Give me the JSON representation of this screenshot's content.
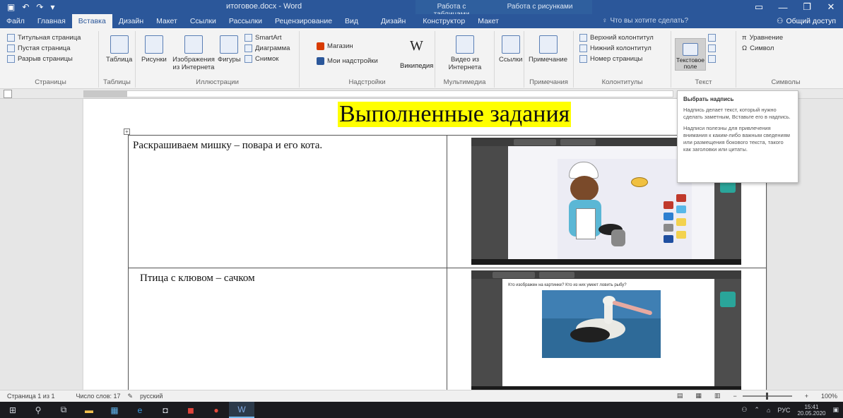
{
  "titlebar": {
    "save_icon": "save-icon",
    "undo_icon": "undo-icon",
    "redo_icon": "redo-icon",
    "doc_title": "итоговое.docx - Word",
    "ctx_tables": "Работа с таблицами",
    "ctx_pictures": "Работа с рисунками",
    "minimize": "—",
    "maximize": "❐",
    "close": "✕"
  },
  "tabs": [
    "Файл",
    "Главная",
    "Вставка",
    "Дизайн",
    "Макет",
    "Ссылки",
    "Рассылки",
    "Рецензирование",
    "Вид",
    "Дизайн",
    "Конструктор",
    "Макет"
  ],
  "active_tab_index": 2,
  "tell_me": "Что вы хотите сделать?",
  "share_label": "Общий доступ",
  "ribbon": {
    "pages": [
      "Титульная страница",
      "Пустая страница",
      "Разрыв страницы"
    ],
    "pages_label": "Страницы",
    "table_btn": "Таблица",
    "tables_label": "Таблицы",
    "pictures": "Рисунки",
    "online_pictures": "Изображения из Интернета",
    "shapes": "Фигуры",
    "smartart": "SmartArt",
    "chart": "Диаграмма",
    "screenshot": "Снимок",
    "illustrations_label": "Иллюстрации",
    "store": "Магазин",
    "my_addins": "Мои надстройки",
    "wikipedia": "Википедия",
    "addins_label": "Надстройки",
    "online_video": "Видео из Интернета",
    "media_label": "Мультимедиа",
    "links": "Ссылки",
    "comment": "Примечание",
    "comments_label": "Примечания",
    "header": "Верхний колонтитул",
    "footer": "Нижний колонтитул",
    "page_number": "Номер страницы",
    "hf_label": "Колонтитулы",
    "text_box": "Текстовое поле",
    "text_label": "Текст",
    "equation": "Уравнение",
    "symbol": "Символ",
    "symbols_label": "Символы"
  },
  "tooltip": {
    "title": "Выбрать надпись",
    "p1": "Надпись делает текст, который нужно сделать заметным, Вставьте его в надпись.",
    "p2": "Надписи полезны для привлечения внимания к каким-либо важным сведениям или размещения бокового текста, такого как заголовки или цитаты."
  },
  "document": {
    "heading": "Выполненные задания",
    "rows": [
      {
        "text": "Раскрашиваем мишку – повара и его кота."
      },
      {
        "text": "Птица с клювом – сачком",
        "question": "Кто изображен на картинке? Кто из них умеет ловить рыбу?"
      }
    ]
  },
  "statusbar": {
    "page": "Страница 1 из 1",
    "words": "Число слов: 17",
    "lang": "русский",
    "zoom": "100%",
    "zoom_level": 1.0
  },
  "taskbar": {
    "items": [
      "windows-start-icon",
      "search-icon",
      "task-view-icon",
      "file-explorer-icon",
      "photos-icon",
      "edge-icon",
      "store-icon",
      "pdf-icon",
      "yandex-browser-icon",
      "word-icon"
    ],
    "active_item": "word-icon",
    "lang": "РУС",
    "time": "15:41",
    "date": "20.05.2020"
  },
  "colors": {
    "word_blue": "#2b579a",
    "heading_highlight": "#ffff00",
    "taskbar": "#1b1b1f"
  }
}
